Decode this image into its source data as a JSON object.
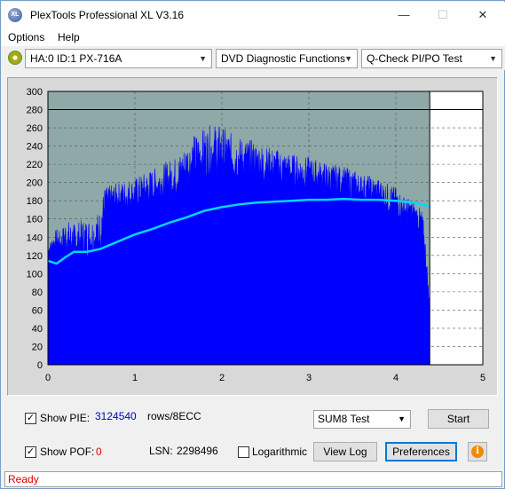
{
  "window": {
    "title": "PlexTools Professional XL V3.16",
    "icon_text": "XL",
    "minimize": "—",
    "maximize": "☐",
    "close": "✕"
  },
  "menu": {
    "items": [
      "Options",
      "Help"
    ]
  },
  "toolbar": {
    "drive": "HA:0 ID:1  PX-716A",
    "function": "DVD Diagnostic Functions",
    "test": "Q-Check PI/PO Test"
  },
  "chart_data": {
    "type": "area",
    "xlim": [
      0,
      5
    ],
    "ylim": [
      0,
      300
    ],
    "x_ticks": [
      "0",
      "1",
      "2",
      "3",
      "4",
      "5"
    ],
    "y_ticks": [
      "0",
      "20",
      "40",
      "60",
      "80",
      "100",
      "120",
      "140",
      "160",
      "180",
      "200",
      "220",
      "240",
      "260",
      "280",
      "300"
    ],
    "grid": true,
    "background": "#8fa8a8",
    "reference_line_y": 280,
    "end_marker_x": 4.39,
    "series": [
      {
        "color": "#0000ff",
        "envelope": [
          [
            0,
            130
          ],
          [
            0.05,
            140
          ],
          [
            0.1,
            150
          ],
          [
            0.15,
            145
          ],
          [
            0.2,
            160
          ],
          [
            0.3,
            155
          ],
          [
            0.4,
            160
          ],
          [
            0.5,
            162
          ],
          [
            0.6,
            170
          ],
          [
            0.65,
            195
          ],
          [
            0.8,
            200
          ],
          [
            1.0,
            205
          ],
          [
            1.1,
            210
          ],
          [
            1.2,
            215
          ],
          [
            1.3,
            220
          ],
          [
            1.4,
            225
          ],
          [
            1.5,
            230
          ],
          [
            1.6,
            245
          ],
          [
            1.7,
            255
          ],
          [
            1.8,
            260
          ],
          [
            1.9,
            265
          ],
          [
            2.0,
            262
          ],
          [
            2.1,
            255
          ],
          [
            2.2,
            250
          ],
          [
            2.3,
            248
          ],
          [
            2.4,
            245
          ],
          [
            2.5,
            240
          ],
          [
            2.6,
            238
          ],
          [
            2.7,
            235
          ],
          [
            2.8,
            232
          ],
          [
            2.9,
            230
          ],
          [
            3.0,
            228
          ],
          [
            3.1,
            225
          ],
          [
            3.2,
            222
          ],
          [
            3.3,
            220
          ],
          [
            3.4,
            218
          ],
          [
            3.5,
            215
          ],
          [
            3.6,
            210
          ],
          [
            3.7,
            208
          ],
          [
            3.8,
            205
          ],
          [
            3.9,
            200
          ],
          [
            4.0,
            195
          ],
          [
            4.1,
            185
          ],
          [
            4.2,
            180
          ],
          [
            4.25,
            175
          ],
          [
            4.3,
            170
          ],
          [
            4.33,
            150
          ],
          [
            4.36,
            110
          ],
          [
            4.39,
            60
          ]
        ],
        "base": [
          [
            0,
            120
          ],
          [
            0.05,
            125
          ],
          [
            0.1,
            122
          ],
          [
            0.2,
            120
          ],
          [
            0.4,
            115
          ],
          [
            0.6,
            118
          ],
          [
            0.65,
            160
          ],
          [
            0.8,
            165
          ],
          [
            1.0,
            170
          ],
          [
            1.2,
            175
          ],
          [
            1.4,
            180
          ],
          [
            1.6,
            190
          ],
          [
            1.8,
            200
          ],
          [
            2.0,
            205
          ],
          [
            2.2,
            200
          ],
          [
            2.4,
            198
          ],
          [
            2.6,
            195
          ],
          [
            2.8,
            192
          ],
          [
            3.0,
            190
          ],
          [
            3.2,
            185
          ],
          [
            3.4,
            180
          ],
          [
            3.6,
            175
          ],
          [
            3.8,
            170
          ],
          [
            4.0,
            160
          ],
          [
            4.2,
            150
          ],
          [
            4.3,
            140
          ],
          [
            4.36,
            90
          ],
          [
            4.39,
            50
          ]
        ]
      },
      {
        "color": "#00d8ff",
        "points": [
          [
            0,
            114
          ],
          [
            0.1,
            111
          ],
          [
            0.2,
            118
          ],
          [
            0.3,
            124
          ],
          [
            0.45,
            124
          ],
          [
            0.6,
            127
          ],
          [
            0.8,
            135
          ],
          [
            1.0,
            143
          ],
          [
            1.2,
            149
          ],
          [
            1.4,
            156
          ],
          [
            1.6,
            162
          ],
          [
            1.8,
            169
          ],
          [
            2.0,
            173
          ],
          [
            2.2,
            176
          ],
          [
            2.4,
            178
          ],
          [
            2.6,
            179
          ],
          [
            2.8,
            180
          ],
          [
            3.0,
            181
          ],
          [
            3.2,
            181
          ],
          [
            3.4,
            182
          ],
          [
            3.6,
            181
          ],
          [
            3.8,
            181
          ],
          [
            4.0,
            180
          ],
          [
            4.2,
            178
          ],
          [
            4.39,
            174
          ]
        ]
      }
    ]
  },
  "bottom": {
    "show_pie_label": "Show PIE:",
    "pie_value": "3124540",
    "pie_unit": "rows/8ECC",
    "show_pof_label": "Show POF:",
    "pof_value": "0",
    "lsn_label": "LSN:",
    "lsn_value": "2298496",
    "logarithmic_label": "Logarithmic",
    "test_select": "SUM8 Test",
    "start_button": "Start",
    "view_log_button": "View Log",
    "preferences_button": "Preferences",
    "checkbox_mark": "✓"
  },
  "status": {
    "text": "Ready"
  }
}
